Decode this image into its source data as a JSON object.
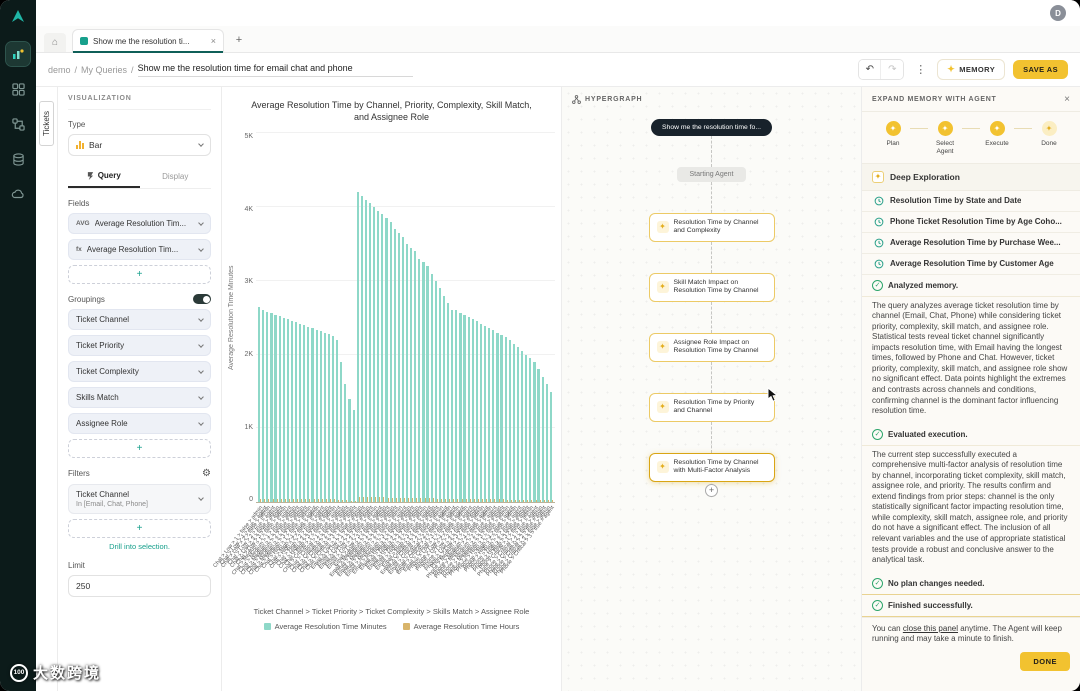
{
  "window": {
    "avatar": "D"
  },
  "icons": {
    "home": "⌂",
    "close": "×",
    "plus": "+",
    "undo": "↶",
    "redo": "↷",
    "kebab": "⋮",
    "sparkle": "✦",
    "gear": "⚙",
    "check": "✓"
  },
  "tabs": {
    "active_tab": "Show me the resolution ti...",
    "new_tab": "+"
  },
  "breadcrumb": {
    "items": [
      "demo",
      "My Queries",
      "Show me the resolution time for email chat and phone"
    ]
  },
  "toolbar": {
    "memory_label": "MEMORY",
    "save_as_label": "SAVE AS"
  },
  "viz_panel": {
    "tickets_tab": "Tickets",
    "header": "VISUALIZATION",
    "type_label": "Type",
    "type_value": "Bar",
    "tabs": {
      "query": "Query",
      "display": "Display"
    },
    "fields_label": "Fields",
    "fields": [
      {
        "badge": "AVG",
        "label": "Average Resolution Tim..."
      },
      {
        "badge": "fx",
        "label": "Average Resolution Tim..."
      }
    ],
    "add_label": "+",
    "groupings_label": "Groupings",
    "groupings": [
      "Ticket Channel",
      "Ticket Priority",
      "Ticket Complexity",
      "Skills Match",
      "Assignee Role"
    ],
    "filters_label": "Filters",
    "filter": {
      "title": "Ticket Channel",
      "subtitle": "In [Email, Chat, Phone]"
    },
    "drill_label": "Drill into selection.",
    "limit_label": "Limit",
    "limit_value": "250"
  },
  "chart_data": {
    "type": "bar",
    "title": "Average Resolution Time by Channel, Priority, Complexity, Skill Match, and Assignee Role",
    "ylabel": "Average Resolution Time Minutes",
    "ylim": [
      0,
      5000
    ],
    "yticks": [
      "5K",
      "4K",
      "3K",
      "2K",
      "1K",
      "0"
    ],
    "grid": true,
    "legend_position": "bottom",
    "hierarchy_label": "Ticket Channel > Ticket Priority > Ticket Complexity > Skills Match > Assignee Role",
    "categories": [
      "Chat > Low > 1 > false > admin",
      "Chat > Low > 1 > true > agent",
      "Chat > Low > 2 > false > admin",
      "Chat > Low > 2 > true > agent",
      "Chat > Low > 3 > false > admin",
      "Chat > Low > 3 > true > agent",
      "Chat > Medium > 1 > false > admin",
      "Chat > Medium > 1 > true > agent",
      "Chat > Medium > 2 > false > admin",
      "Chat > Medium > 2 > true > agent",
      "Chat > Medium > 3 > false > admin",
      "Chat > Medium > 3 > true > agent",
      "Chat > High > 1 > false > admin",
      "Chat > High > 1 > true > agent",
      "Chat > High > 2 > false > admin",
      "Chat > High > 2 > true > agent",
      "Chat > High > 3 > false > admin",
      "Chat > High > 3 > true > agent",
      "Chat > Critical > 1 > false > admin",
      "Chat > Critical > 1 > true > agent",
      "Chat > Critical > 2 > false > admin",
      "Chat > Critical > 2 > true > agent",
      "Chat > Critical > 3 > false > admin",
      "Chat > Critical > 3 > true > agent",
      "Email > Low > 1 > false > admin",
      "Email > Low > 1 > true > agent",
      "Email > Low > 2 > false > admin",
      "Email > Low > 2 > true > agent",
      "Email > Low > 3 > false > admin",
      "Email > Low > 3 > true > agent",
      "Email > Medium > 1 > false > admin",
      "Email > Medium > 1 > true > agent",
      "Email > Medium > 2 > false > admin",
      "Email > Medium > 2 > true > agent",
      "Email > Medium > 3 > false > admin",
      "Email > Medium > 3 > true > agent",
      "Email > High > 1 > false > admin",
      "Email > High > 1 > true > agent",
      "Email > High > 2 > false > admin",
      "Email > High > 2 > true > agent",
      "Email > High > 3 > false > admin",
      "Email > High > 3 > true > agent",
      "Email > Critical > 1 > false > admin",
      "Email > Critical > 1 > true > agent",
      "Email > Critical > 2 > false > admin",
      "Email > Critical > 2 > true > agent",
      "Email > Critical > 3 > false > admin",
      "Email > Critical > 3 > true > agent",
      "Phone > Low > 1 > false > admin",
      "Phone > Low > 1 > true > agent",
      "Phone > Low > 2 > false > admin",
      "Phone > Low > 2 > true > agent",
      "Phone > Low > 3 > false > admin",
      "Phone > Low > 3 > true > agent",
      "Phone > Medium > 1 > false > admin",
      "Phone > Medium > 1 > true > agent",
      "Phone > Medium > 2 > false > admin",
      "Phone > Medium > 2 > true > agent",
      "Phone > Medium > 3 > false > admin",
      "Phone > Medium > 3 > true > agent",
      "Phone > High > 1 > false > admin",
      "Phone > High > 1 > true > agent",
      "Phone > High > 2 > false > admin",
      "Phone > High > 2 > true > agent",
      "Phone > High > 3 > false > admin",
      "Phone > High > 3 > true > agent",
      "Phone > Critical > 1 > false > admin",
      "Phone > Critical > 1 > true > agent",
      "Phone > Critical > 2 > false > admin",
      "Phone > Critical > 2 > true > agent",
      "Phone > Critical > 3 > false > admin",
      "Phone > Critical > 3 > true > agent"
    ],
    "series": [
      {
        "name": "Average Resolution Time Minutes",
        "color": "#8ed8c8",
        "values": [
          2650,
          2600,
          2580,
          2560,
          2540,
          2520,
          2500,
          2480,
          2460,
          2440,
          2420,
          2400,
          2380,
          2360,
          2340,
          2320,
          2300,
          2280,
          2250,
          2200,
          1900,
          1600,
          1400,
          1250,
          4200,
          4150,
          4100,
          4050,
          4000,
          3950,
          3900,
          3850,
          3800,
          3700,
          3650,
          3600,
          3500,
          3450,
          3400,
          3300,
          3250,
          3200,
          3100,
          3000,
          2900,
          2800,
          2700,
          2600,
          2600,
          2570,
          2540,
          2510,
          2480,
          2450,
          2420,
          2390,
          2360,
          2330,
          2300,
          2270,
          2240,
          2200,
          2150,
          2100,
          2050,
          2000,
          1950,
          1900,
          1800,
          1700,
          1600,
          1500
        ]
      },
      {
        "name": "Average Resolution Time Hours",
        "color": "#d8b46a",
        "values": [
          44,
          43,
          43,
          43,
          42,
          42,
          42,
          41,
          41,
          41,
          40,
          40,
          40,
          39,
          39,
          39,
          38,
          38,
          38,
          37,
          32,
          27,
          23,
          21,
          70,
          69,
          68,
          68,
          67,
          66,
          65,
          64,
          63,
          62,
          61,
          60,
          58,
          58,
          57,
          55,
          54,
          53,
          52,
          50,
          48,
          47,
          45,
          43,
          43,
          43,
          42,
          42,
          41,
          41,
          40,
          40,
          39,
          39,
          38,
          38,
          37,
          37,
          36,
          35,
          34,
          33,
          33,
          32,
          30,
          28,
          27,
          25
        ]
      }
    ]
  },
  "hypergraph": {
    "header": "HYPERGRAPH",
    "root_node": "Show me the resolution time fo...",
    "start_node": "Starting Agent",
    "nodes": [
      "Resolution Time by Channel and Complexity",
      "Skill Match Impact on Resolution Time by Channel",
      "Assignee Role Impact on Resolution Time by Channel",
      "Resolution Time by Priority and Channel",
      "Resolution Time by Channel with Multi-Factor Analysis"
    ]
  },
  "agent_panel": {
    "header": "EXPAND MEMORY WITH AGENT",
    "steps": [
      "Plan",
      "Select Agent",
      "Execute",
      "Done"
    ],
    "deep_exploration": "Deep Exploration",
    "memory_items": [
      "Resolution Time by State and Date",
      "Phone Ticket Resolution Time by Age Coho...",
      "Average Resolution Time by Purchase Wee...",
      "Average Resolution Time by Customer Age"
    ],
    "status_analyzed": "Analyzed memory.",
    "analysis_text": "The query analyzes average ticket resolution time by channel (Email, Chat, Phone) while considering ticket priority, complexity, skill match, and assignee role. Statistical tests reveal ticket channel significantly impacts resolution time, with Email having the longest times, followed by Phone and Chat. However, ticket priority, complexity, skill match, and assignee role show no significant effect. Data points highlight the extremes and contrasts across channels and conditions, confirming channel is the dominant factor influencing resolution time.",
    "status_evaluated": "Evaluated execution.",
    "evaluation_text": "The current step successfully executed a comprehensive multi-factor analysis of resolution time by channel, incorporating ticket complexity, skill match, assignee role, and priority. The results confirm and extend findings from prior steps: channel is the only statistically significant factor impacting resolution time, while complexity, skill match, assignee role, and priority do not have a significant effect. The inclusion of all relevant variables and the use of appropriate statistical tests provide a robust and conclusive answer to the analytical task.",
    "status_no_changes": "No plan changes needed.",
    "status_finished": "Finished successfully.",
    "footer_pre": "You can ",
    "footer_link": "close this panel",
    "footer_post": " anytime. The Agent will keep running and may take a minute to finish.",
    "done_label": "DONE"
  },
  "watermark": {
    "badge": "100",
    "text": "大数跨境"
  }
}
